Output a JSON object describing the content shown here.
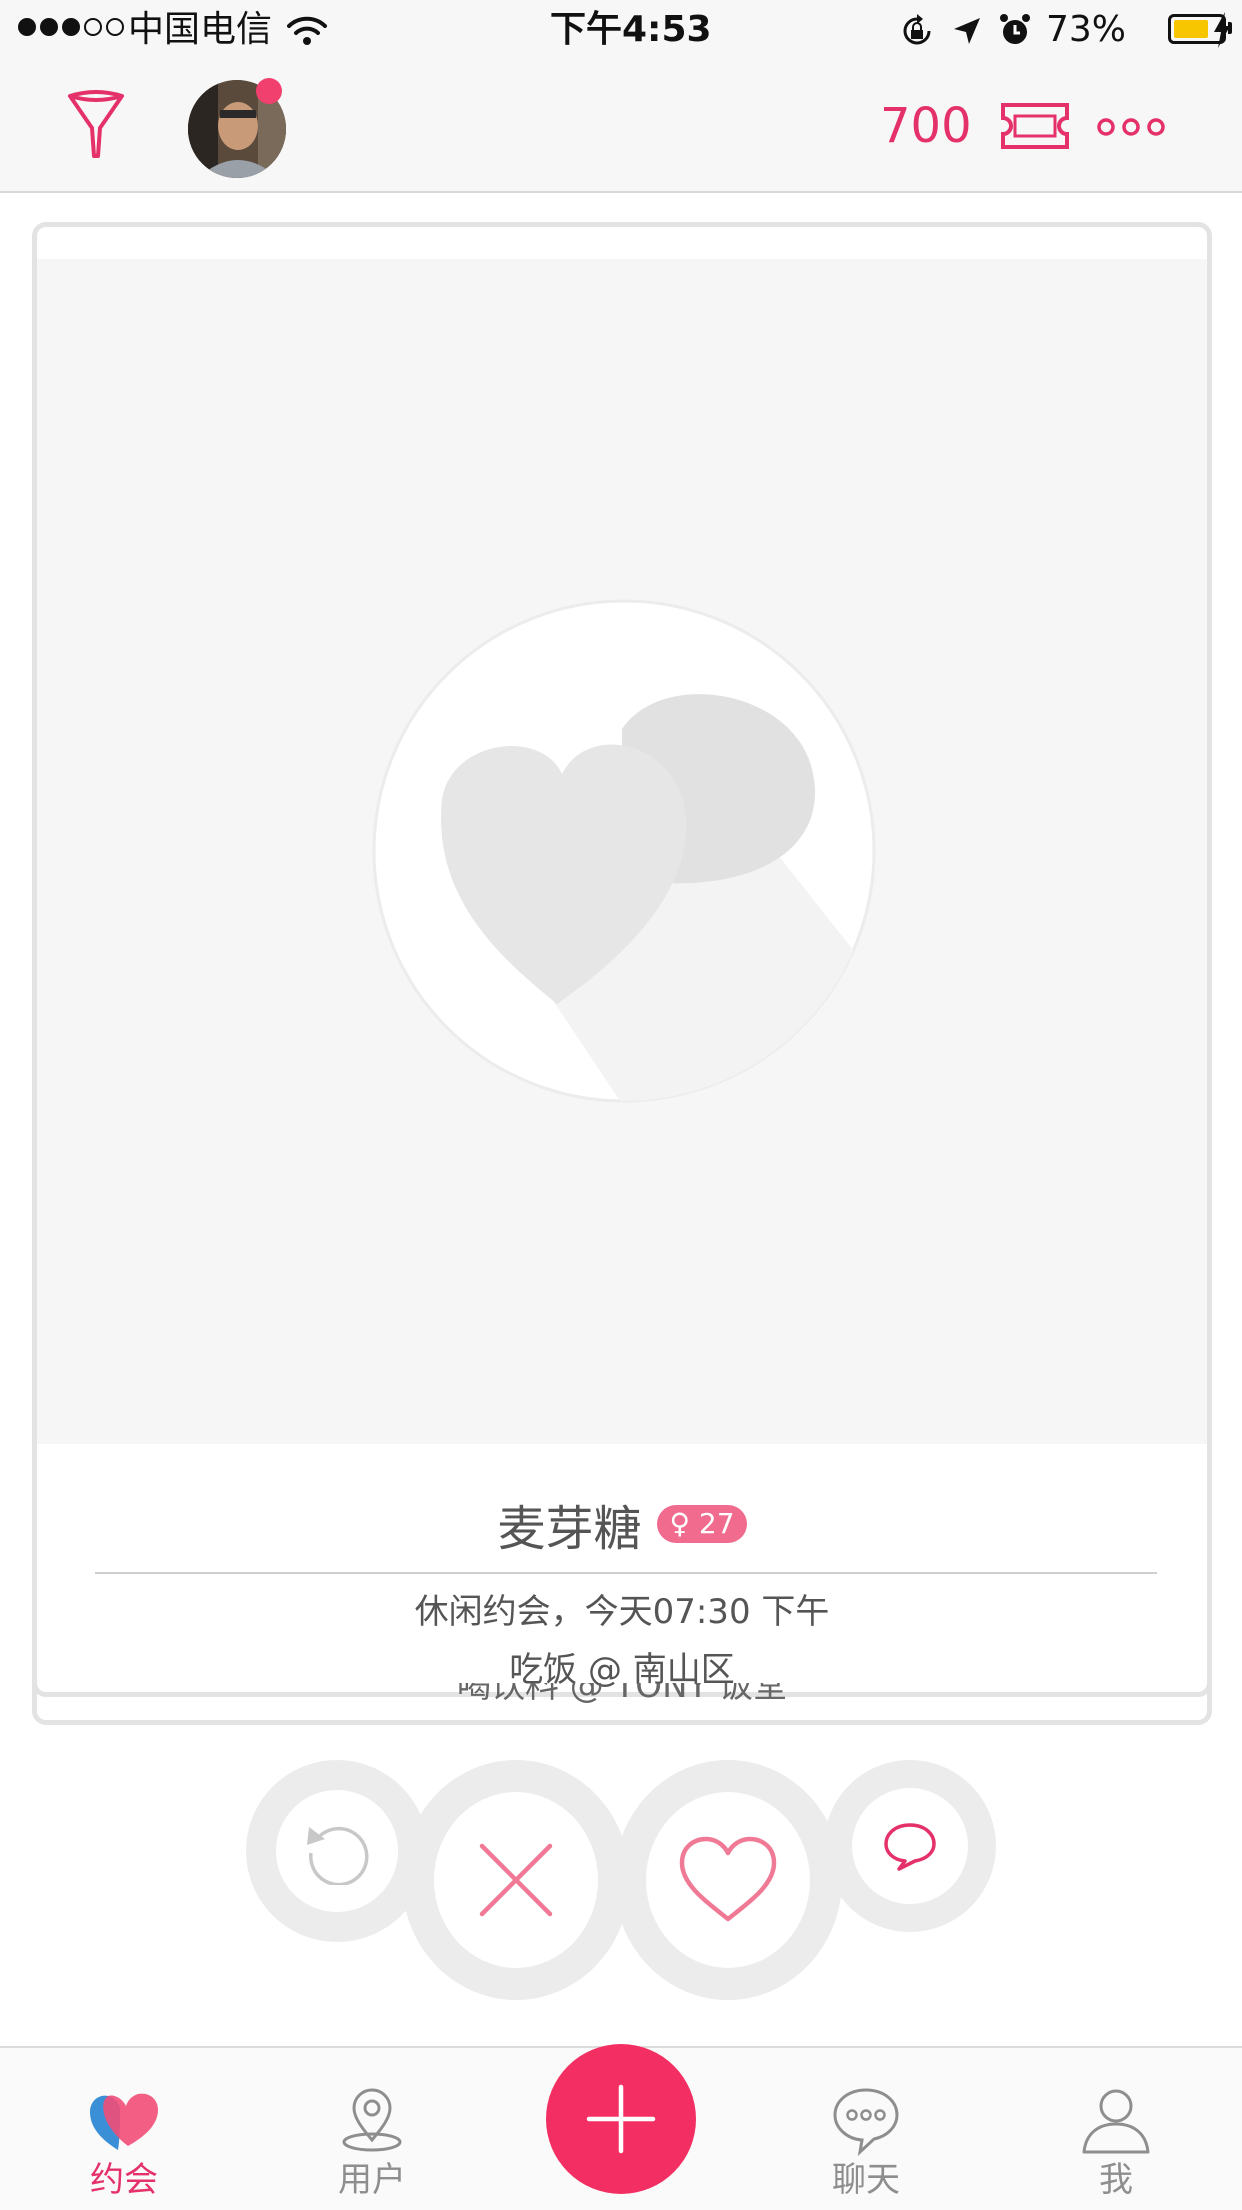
{
  "status_bar": {
    "carrier": "中国电信",
    "time": "下午4:53",
    "battery_percent": "73%",
    "battery_level": 0.73,
    "signal_dots": [
      1,
      1,
      1,
      0,
      0
    ]
  },
  "top_nav": {
    "coins": "700",
    "icons": [
      "filter-icon",
      "avatar",
      "ticket-icon",
      "more-icon"
    ]
  },
  "card": {
    "name": "麦芽糖",
    "gender_age": "♀ 27",
    "date_info": "休闲约会，今天07:30 下午",
    "place_info": "吃饭 @ 南山区",
    "back_card_info": "喝饮料 @ TONY 饭堂"
  },
  "actions": [
    "undo-icon",
    "dislike-icon",
    "like-icon",
    "chat-bubble-icon"
  ],
  "tabs": [
    {
      "label": "约会",
      "icon": "hearts-icon",
      "active": true
    },
    {
      "label": "用户",
      "icon": "location-pin-icon",
      "active": false
    },
    {
      "label": "聊天",
      "icon": "chat-icon",
      "active": false
    },
    {
      "label": "我",
      "icon": "person-icon",
      "active": false
    }
  ],
  "colors": {
    "accent": "#e5316a",
    "add_button": "#f22e62",
    "badge": "#f06b8e",
    "battery": "#f7c600"
  }
}
